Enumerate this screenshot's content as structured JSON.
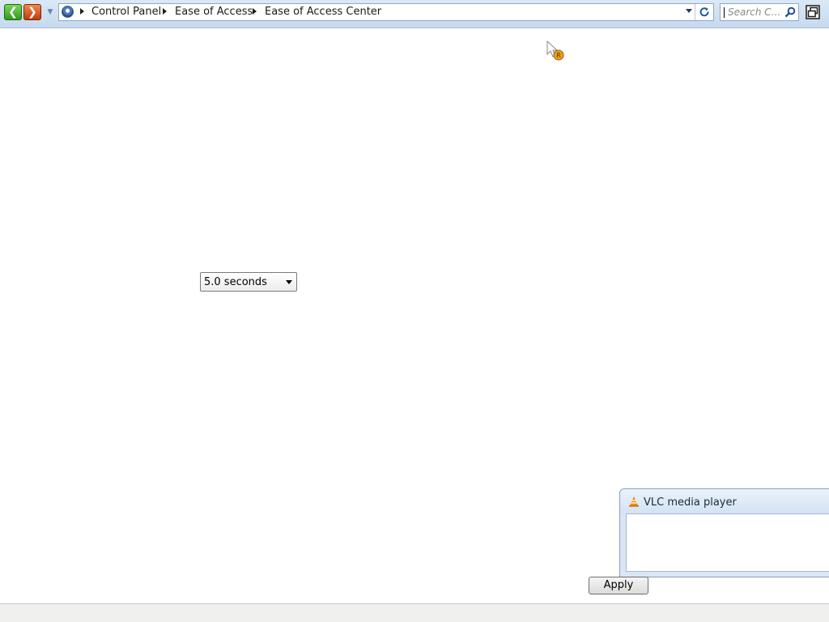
{
  "navigation": {
    "back_label": "Back",
    "forward_label": "Forward"
  },
  "address_bar": {
    "breadcrumbs": [
      "Control Panel",
      "Ease of Access",
      "Ease of Access Center"
    ]
  },
  "search": {
    "placeholder": "Search C..."
  },
  "delay_dropdown": {
    "selected_value": "5.0 seconds"
  },
  "vlc_window": {
    "title": "VLC media player"
  },
  "apply_button": {
    "label": "Apply"
  },
  "icons": {
    "back": "back-arrow-icon",
    "forward": "forward-arrow-icon",
    "control_panel": "control-panel-icon",
    "refresh": "refresh-icon",
    "search": "search-icon",
    "restore": "window-restore-icon",
    "vlc": "vlc-cone-icon",
    "cursor": "mouse-cursor-icon"
  },
  "colors": {
    "navbar_background": "#c6d9ee",
    "back_button": "#2f9a1a",
    "forward_button": "#c23a10",
    "vlc_accent": "#f08a00"
  }
}
